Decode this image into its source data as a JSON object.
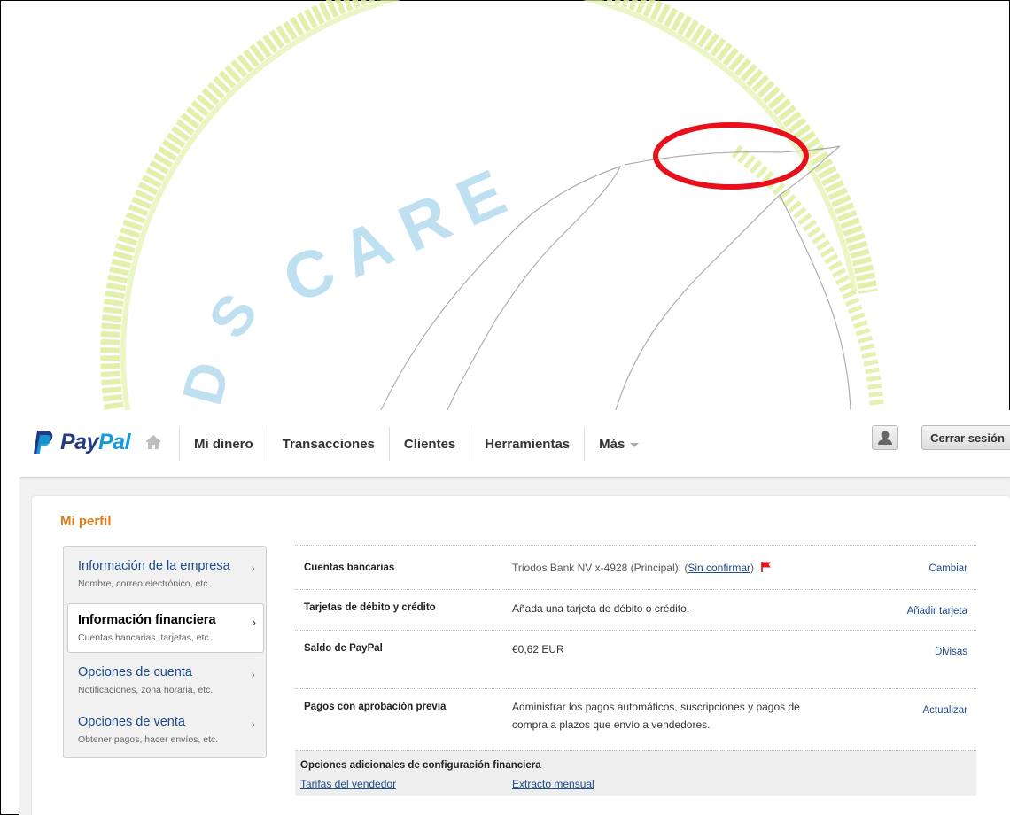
{
  "watermark": {
    "text": "CARE",
    "fragments": [
      "D",
      "S"
    ]
  },
  "header": {
    "brand_pay": "Pay",
    "brand_pal": "Pal",
    "nav": [
      {
        "label": "Mi dinero"
      },
      {
        "label": "Transacciones"
      },
      {
        "label": "Clientes"
      },
      {
        "label": "Herramientas"
      },
      {
        "label": "Más"
      }
    ],
    "logout_label": "Cerrar sesión"
  },
  "page": {
    "title": "Mi perfil"
  },
  "sidebar": {
    "items": [
      {
        "title": "Información de la empresa",
        "subtitle": "Nombre, correo electrónico, etc.",
        "active": false
      },
      {
        "title": "Información financiera",
        "subtitle": "Cuentas bancarias, tarjetas, etc.",
        "active": true
      },
      {
        "title": "Opciones de cuenta",
        "subtitle": "Notificaciones, zona horaria, etc.",
        "active": false
      },
      {
        "title": "Opciones de venta",
        "subtitle": "Obtener pagos, hacer envíos, etc.",
        "active": false
      }
    ]
  },
  "financial": {
    "rows": [
      {
        "label": "Cuentas bancarias",
        "value": "Triodos Bank NV x-4928 (Principal):",
        "link": "Sin confirmar",
        "action": "Cambiar"
      },
      {
        "label": "Tarjetas de débito y crédito",
        "value": "Añada una tarjeta de débito o crédito.",
        "action": "Añadir tarjeta"
      },
      {
        "label": "Saldo de PayPal",
        "value": "€0,62 EUR",
        "action": "Divisas"
      },
      {
        "label": "Pagos con aprobación previa",
        "value_line1": "Administrar los pagos automáticos, suscripciones y pagos de",
        "value_line2": "compra a plazos que envío a vendedores.",
        "action": "Actualizar"
      }
    ],
    "extra": {
      "heading": "Opciones adicionales de configuración financiera",
      "links": [
        "Tarifas del vendedor",
        "Extracto mensual"
      ]
    }
  },
  "colors": {
    "highlight_ellipse": "#e8101a",
    "watermark_green": "#d6ec8c",
    "watermark_blue": "#bfe0f0",
    "link": "#1a4b8c",
    "title_orange": "#e07d1a"
  }
}
